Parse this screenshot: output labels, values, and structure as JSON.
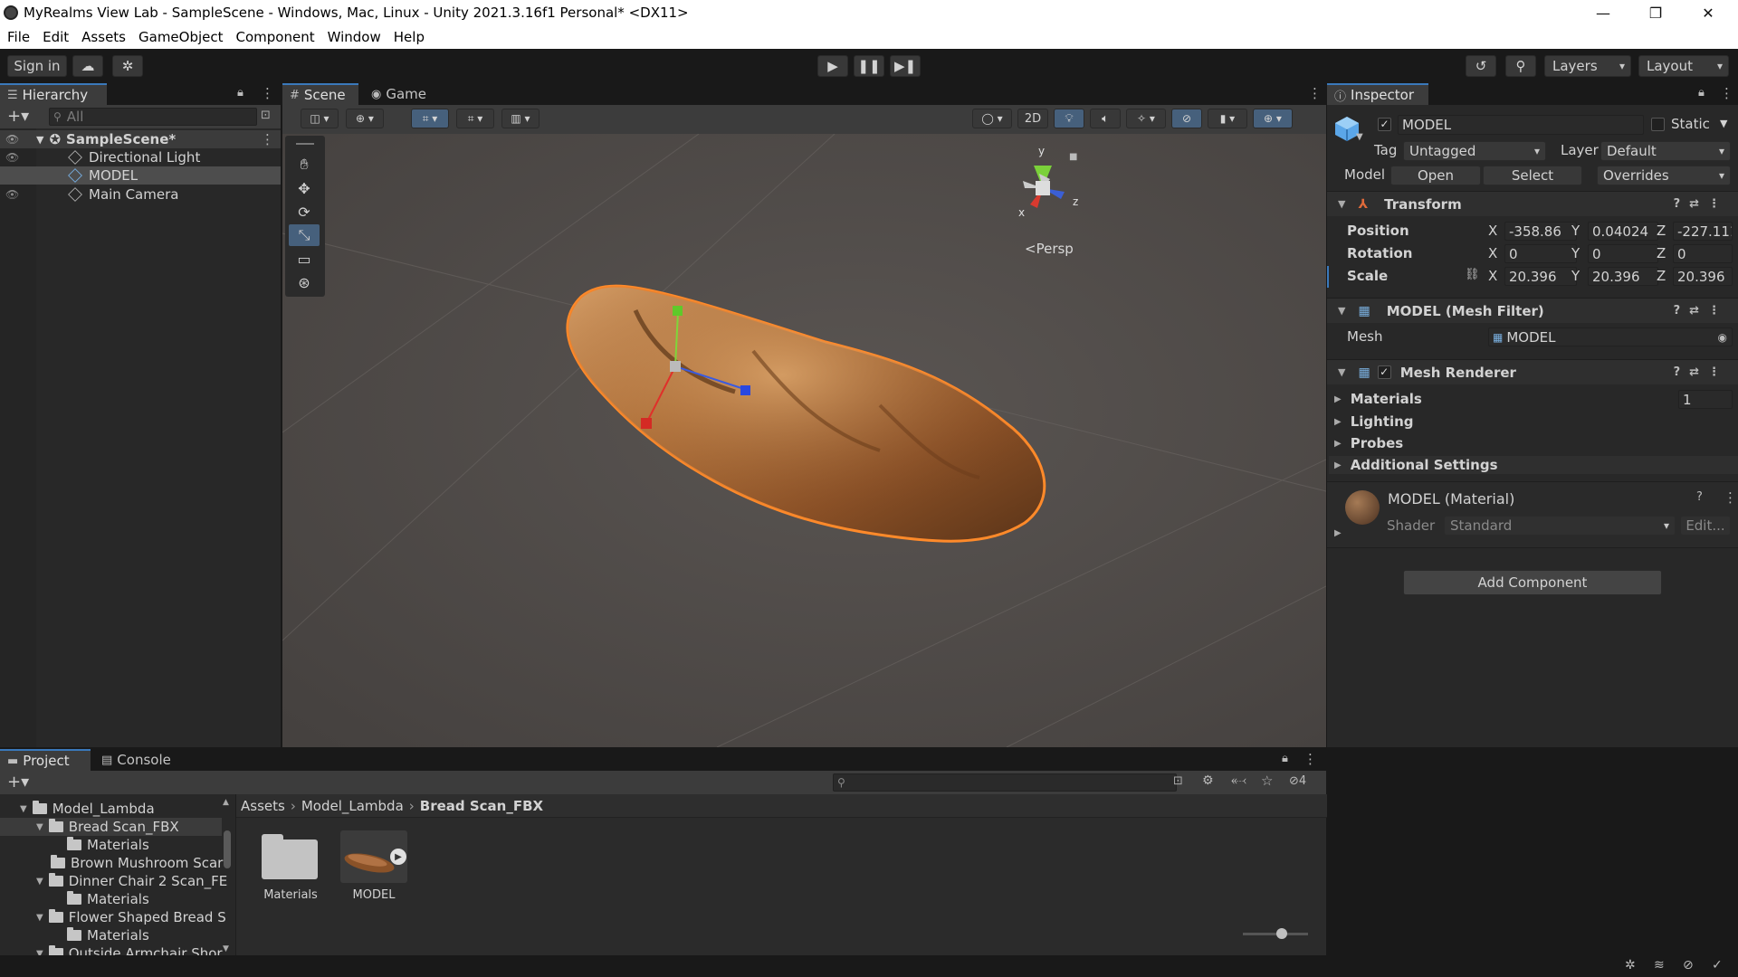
{
  "window": {
    "title": "MyRealms View Lab - SampleScene - Windows, Mac, Linux - Unity 2021.3.16f1 Personal* <DX11>",
    "minimize": "—",
    "maximize": "❐",
    "close": "✕"
  },
  "menu": [
    "File",
    "Edit",
    "Assets",
    "GameObject",
    "Component",
    "Window",
    "Help"
  ],
  "toolbar": {
    "signin": "Sign in",
    "layers": "Layers",
    "layout": "Layout"
  },
  "hierarchy": {
    "tab": "Hierarchy",
    "search_placeholder": "All",
    "scene": "SampleScene*",
    "items": [
      "Directional Light",
      "MODEL",
      "Main Camera"
    ]
  },
  "scene": {
    "tabs": [
      "Scene",
      "Game"
    ],
    "btn_2d": "2D",
    "gizmo_persp": "Persp",
    "axis_x": "x",
    "axis_y": "y",
    "axis_z": "z"
  },
  "inspector": {
    "tab": "Inspector",
    "name": "MODEL",
    "static_label": "Static",
    "tag_label": "Tag",
    "tag_value": "Untagged",
    "layer_label": "Layer",
    "layer_value": "Default",
    "model_label": "Model",
    "open": "Open",
    "select": "Select",
    "overrides": "Overrides",
    "transform": {
      "title": "Transform",
      "position_label": "Position",
      "rotation_label": "Rotation",
      "scale_label": "Scale",
      "position": {
        "x": "-358.86",
        "y": "0.04024",
        "z": "-227.111"
      },
      "rotation": {
        "x": "0",
        "y": "0",
        "z": "0"
      },
      "scale": {
        "x": "20.396",
        "y": "20.396",
        "z": "20.396"
      }
    },
    "meshfilter": {
      "title": "MODEL (Mesh Filter)",
      "mesh_label": "Mesh",
      "mesh_value": "MODEL"
    },
    "meshrenderer": {
      "title": "Mesh Renderer",
      "materials": "Materials",
      "materials_count": "1",
      "lighting": "Lighting",
      "probes": "Probes",
      "additional": "Additional Settings"
    },
    "material": {
      "title": "MODEL (Material)",
      "shader_label": "Shader",
      "shader_value": "Standard",
      "edit": "Edit..."
    },
    "add_component": "Add Component",
    "axis_x": "X",
    "axis_y": "Y",
    "axis_z": "Z"
  },
  "project": {
    "tabs": [
      "Project",
      "Console"
    ],
    "hidden_count": "4",
    "tree": [
      "Model_Lambda",
      "Bread Scan_FBX",
      "Materials",
      "Brown Mushroom Scar",
      "Dinner Chair 2 Scan_FE",
      "Materials",
      "Flower Shaped Bread S",
      "Materials",
      "Outside Armchair Shor"
    ],
    "breadcrumb": [
      "Assets",
      "Model_Lambda",
      "Bread Scan_FBX"
    ],
    "assets": [
      "Materials",
      "MODEL"
    ]
  }
}
